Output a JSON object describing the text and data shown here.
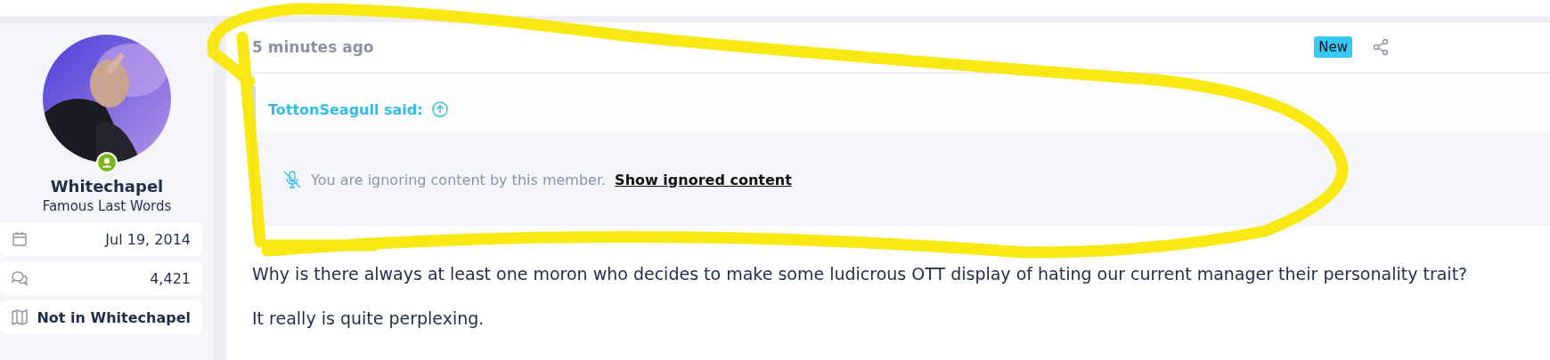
{
  "user": {
    "name": "Whitechapel",
    "title": "Famous Last Words",
    "online": true,
    "stats": [
      {
        "kind": "joined",
        "value": "Jul 19, 2014"
      },
      {
        "kind": "messages",
        "value": "4,421"
      },
      {
        "kind": "location",
        "value": "Not in Whitechapel"
      }
    ]
  },
  "post": {
    "time": "5 minutes ago",
    "badge": "New",
    "quote": {
      "author": "TottonSeagull said:",
      "notice": "You are ignoring content by this member.",
      "link": "Show ignored content"
    },
    "paragraphs": [
      "Why is there always at least one moron who decides to make some ludicrous OTT display of hating our current manager their personality trait?",
      "It really is quite perplexing."
    ]
  },
  "annotation": {
    "kind": "scribble"
  }
}
